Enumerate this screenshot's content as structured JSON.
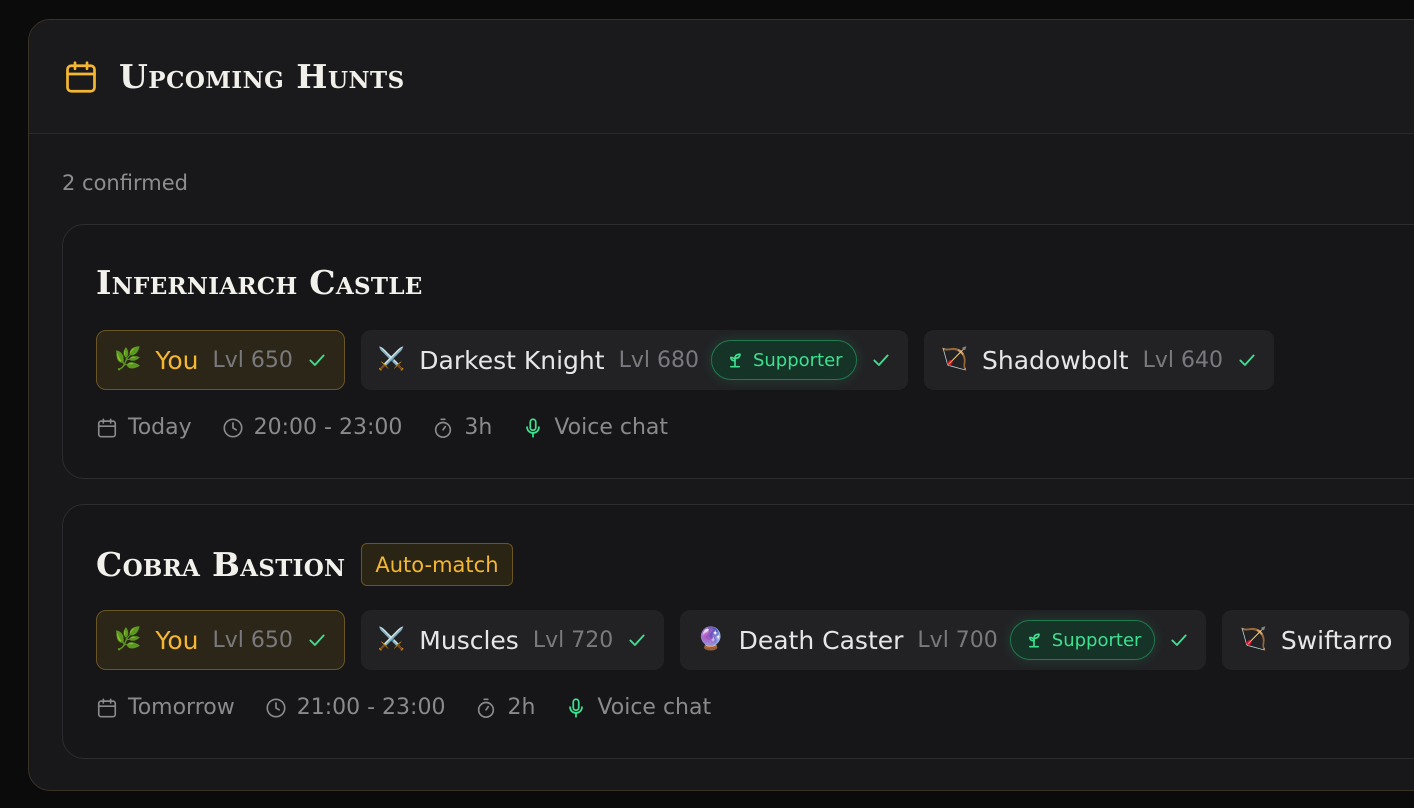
{
  "header": {
    "title": "Upcoming Hunts"
  },
  "summary": {
    "confirmed": "2 confirmed"
  },
  "colors": {
    "accent": "#f5b731",
    "supporter_green": "#3ee08f"
  },
  "hunts": [
    {
      "title": "Inferniarch Castle",
      "badge": "",
      "members": [
        {
          "emoji": "🌿",
          "name": "You",
          "level": "Lvl 650",
          "supporter_label": ""
        },
        {
          "emoji": "⚔️",
          "name": "Darkest Knight",
          "level": "Lvl 680",
          "supporter_label": "Supporter"
        },
        {
          "emoji": "🏹",
          "name": "Shadowbolt",
          "level": "Lvl 640",
          "supporter_label": ""
        }
      ],
      "meta": {
        "day": "Today",
        "time": "20:00 - 23:00",
        "duration": "3h",
        "voice": "Voice chat"
      }
    },
    {
      "title": "Cobra Bastion",
      "badge": "Auto-match",
      "members": [
        {
          "emoji": "🌿",
          "name": "You",
          "level": "Lvl 650",
          "supporter_label": ""
        },
        {
          "emoji": "⚔️",
          "name": "Muscles",
          "level": "Lvl 720",
          "supporter_label": ""
        },
        {
          "emoji": "🔮",
          "name": "Death Caster",
          "level": "Lvl 700",
          "supporter_label": "Supporter"
        },
        {
          "emoji": "🏹",
          "name": "Swiftarro",
          "level": "",
          "supporter_label": ""
        }
      ],
      "meta": {
        "day": "Tomorrow",
        "time": "21:00 - 23:00",
        "duration": "2h",
        "voice": "Voice chat"
      }
    }
  ]
}
